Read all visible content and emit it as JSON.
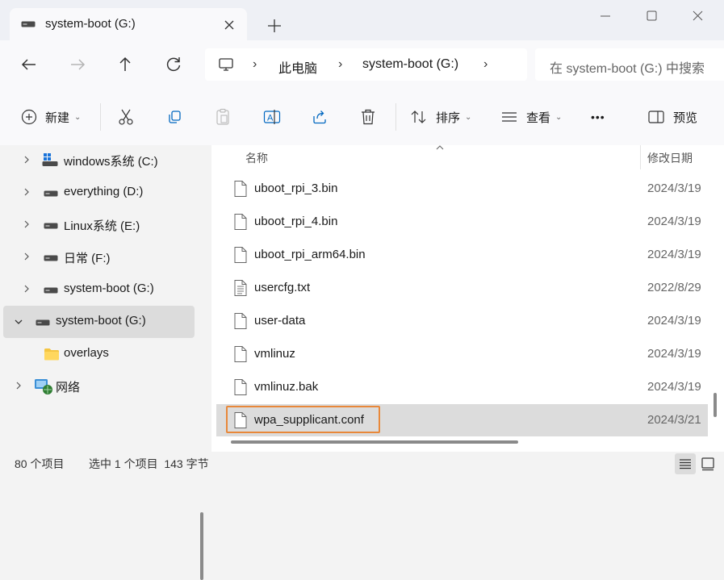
{
  "tab": {
    "title": "system-boot (G:)"
  },
  "breadcrumb": {
    "items": [
      "此电脑",
      "system-boot (G:)"
    ]
  },
  "search": {
    "placeholder": "在 system-boot (G:) 中搜索"
  },
  "toolbar": {
    "new_label": "新建",
    "sort_label": "排序",
    "view_label": "查看",
    "more_label": "•••",
    "preview_label": "预览"
  },
  "sidebar": {
    "items": [
      {
        "label": "windows系统 (C:)",
        "icon": "windows-drive-icon"
      },
      {
        "label": "everything (D:)",
        "icon": "drive-icon"
      },
      {
        "label": "Linux系统 (E:)",
        "icon": "drive-icon"
      },
      {
        "label": "日常 (F:)",
        "icon": "drive-icon"
      },
      {
        "label": "system-boot (G:)",
        "icon": "drive-icon"
      },
      {
        "label": "system-boot (G:)",
        "icon": "drive-icon",
        "expanded": true,
        "selected": true
      },
      {
        "label": "overlays",
        "icon": "folder-icon"
      },
      {
        "label": "网络",
        "icon": "network-icon"
      }
    ]
  },
  "file_list": {
    "columns": {
      "name": "名称",
      "modified": "修改日期"
    },
    "rows": [
      {
        "name": "uboot_rpi_3.bin",
        "date": "2024/3/19",
        "icon": "file-icon"
      },
      {
        "name": "uboot_rpi_4.bin",
        "date": "2024/3/19",
        "icon": "file-icon"
      },
      {
        "name": "uboot_rpi_arm64.bin",
        "date": "2024/3/19",
        "icon": "file-icon"
      },
      {
        "name": "usercfg.txt",
        "date": "2022/8/29",
        "icon": "text-file-icon"
      },
      {
        "name": "user-data",
        "date": "2024/3/19",
        "icon": "file-icon"
      },
      {
        "name": "vmlinuz",
        "date": "2024/3/19",
        "icon": "file-icon"
      },
      {
        "name": "vmlinuz.bak",
        "date": "2024/3/19",
        "icon": "file-icon"
      },
      {
        "name": "wpa_supplicant.conf",
        "date": "2024/3/21",
        "icon": "file-icon",
        "selected": true
      }
    ]
  },
  "status": {
    "item_count": "80 个项目",
    "selection": "选中 1 个项目  143 字节"
  },
  "colors": {
    "selection": "#dcdcdc",
    "focus_outline": "#e8883a",
    "accent": "#0067c0"
  }
}
